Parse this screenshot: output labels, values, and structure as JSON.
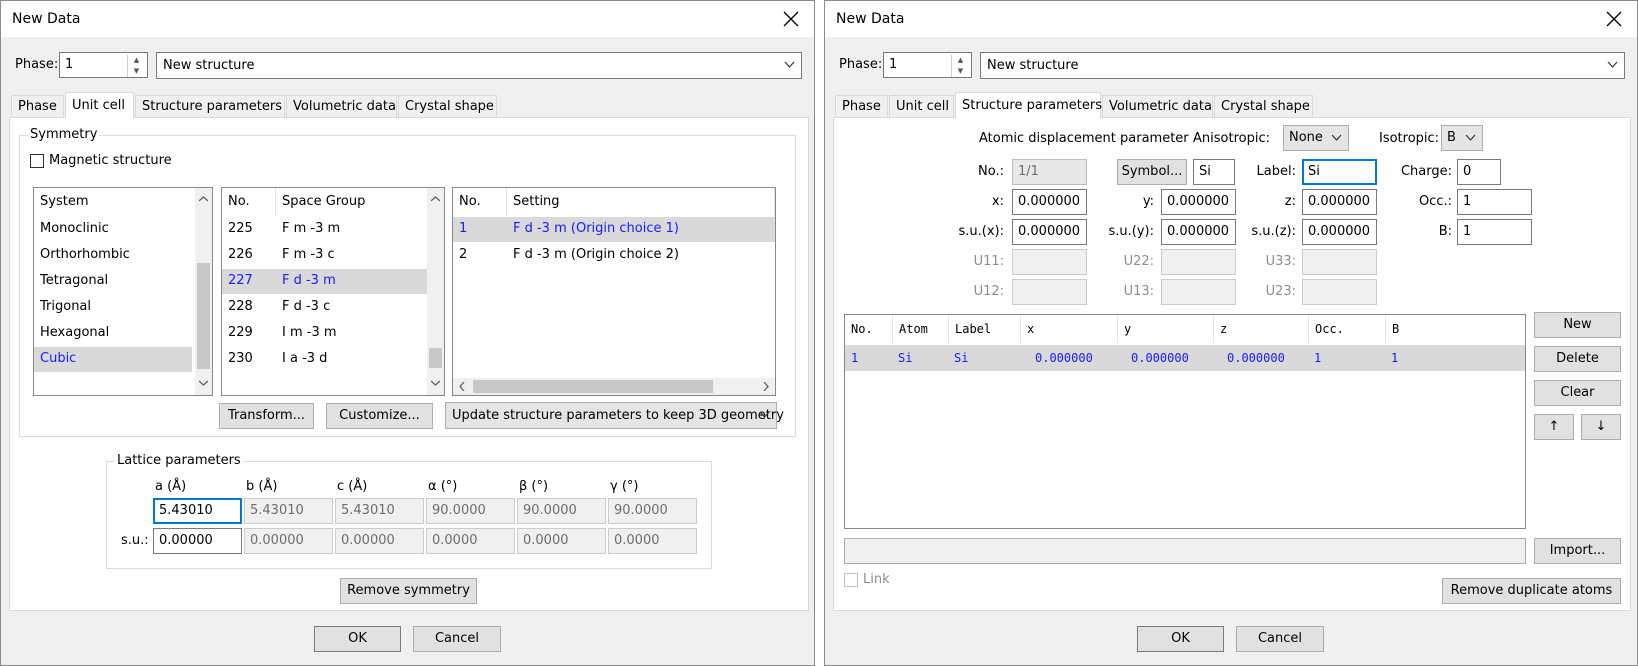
{
  "left": {
    "title": "New Data",
    "phase_label": "Phase:",
    "phase_value": "1",
    "structure_name": "New structure",
    "tabs": [
      "Phase",
      "Unit cell",
      "Structure parameters",
      "Volumetric data",
      "Crystal shape"
    ],
    "symmetry": {
      "title": "Symmetry",
      "magnetic_label": "Magnetic structure",
      "system_header": "System",
      "systems": [
        "Monoclinic",
        "Orthorhombic",
        "Tetragonal",
        "Trigonal",
        "Hexagonal",
        "Cubic"
      ],
      "selected_system": "Cubic",
      "sg_headers": [
        "No.",
        "Space Group"
      ],
      "space_groups": [
        {
          "no": "225",
          "name": "F m -3 m"
        },
        {
          "no": "226",
          "name": "F m -3 c"
        },
        {
          "no": "227",
          "name": "F d -3 m"
        },
        {
          "no": "228",
          "name": "F d -3 c"
        },
        {
          "no": "229",
          "name": "I m -3 m"
        },
        {
          "no": "230",
          "name": "I a -3 d"
        }
      ],
      "setting_headers": [
        "No.",
        "Setting"
      ],
      "settings": [
        {
          "no": "1",
          "name": "F d -3 m (Origin choice 1)"
        },
        {
          "no": "2",
          "name": "F d -3 m (Origin choice 2)"
        }
      ],
      "transform_label": "Transform...",
      "customize_label": "Customize...",
      "update_option": "Update structure parameters to keep 3D geometry"
    },
    "lattice": {
      "title": "Lattice parameters",
      "headers": [
        "a (Å)",
        "b (Å)",
        "c (Å)",
        "α (°)",
        "β (°)",
        "γ (°)"
      ],
      "values": [
        "5.43010",
        "5.43010",
        "5.43010",
        "90.0000",
        "90.0000",
        "90.0000"
      ],
      "su_label": "s.u.:",
      "su_values": [
        "0.00000",
        "0.00000",
        "0.00000",
        "0.0000",
        "0.0000",
        "0.0000"
      ],
      "remove_symmetry_label": "Remove symmetry"
    },
    "ok_label": "OK",
    "cancel_label": "Cancel"
  },
  "right": {
    "title": "New Data",
    "phase_label": "Phase:",
    "phase_value": "1",
    "structure_name": "New structure",
    "tabs": [
      "Phase",
      "Unit cell",
      "Structure parameters",
      "Volumetric data",
      "Crystal shape"
    ],
    "adp_label": "Atomic displacement parameter",
    "anisotropic_label": "Anisotropic:",
    "anisotropic_value": "None",
    "isotropic_label": "Isotropic:",
    "isotropic_value": "B",
    "no_label": "No.:",
    "no_value": "1/1",
    "symbol_button": "Symbol...",
    "symbol_value": "Si",
    "label_label": "Label:",
    "label_value": "Si",
    "charge_label": "Charge:",
    "charge_value": "0",
    "x_label": "x:",
    "x_value": "0.000000",
    "y_label": "y:",
    "y_value": "0.000000",
    "z_label": "z:",
    "z_value": "0.000000",
    "occ_label": "Occ.:",
    "occ_value": "1",
    "sux_label": "s.u.(x):",
    "sux_value": "0.000000",
    "suy_label": "s.u.(y):",
    "suy_value": "0.000000",
    "suz_label": "s.u.(z):",
    "suz_value": "0.000000",
    "b_label": "B:",
    "b_value": "1",
    "u_labels": [
      "U11:",
      "U22:",
      "U33:",
      "U12:",
      "U13:",
      "U23:"
    ],
    "atoms_headers": [
      "No.",
      "Atom",
      "Label",
      "x",
      "y",
      "z",
      "Occ.",
      "B"
    ],
    "atoms": [
      {
        "no": "1",
        "atom": "Si",
        "label": "Si",
        "x": "0.000000",
        "y": "0.000000",
        "z": "0.000000",
        "occ": "1",
        "b": "1"
      }
    ],
    "new_label": "New",
    "delete_label": "Delete",
    "clear_label": "Clear",
    "up_arrow": "↑",
    "down_arrow": "↓",
    "import_label": "Import...",
    "link_label": "Link",
    "remove_dup_label": "Remove duplicate atoms",
    "ok_label": "OK",
    "cancel_label": "Cancel"
  }
}
